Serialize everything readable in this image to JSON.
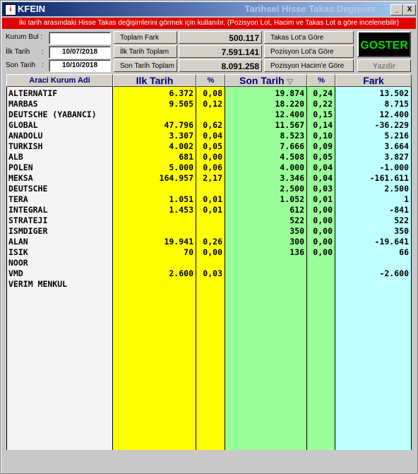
{
  "window": {
    "app_name": "KFEIN",
    "title": "Tarihsel Hisse Takas Degisimi",
    "icon": "app-icon",
    "min_label": "_",
    "close_label": "X"
  },
  "info_banner": "İki tarih arasındaki Hisse Takas değişimlerini görmek için kullanılır. (Pozisyon Lot, Hacim ve Takas Lot a göre incelenebilir)",
  "form": {
    "kurum_bul_label": "Kurum Bul :",
    "kurum_bul_value": "",
    "ilk_tarih_label": "İlk Tarih",
    "ilk_tarih_value": "10/07/2018",
    "son_tarih_label": "Son Tarih",
    "colon": ":",
    "son_tarih_value": "10/10/2018"
  },
  "totals": {
    "toplam_fark_label": "Toplam Fark",
    "toplam_fark_value": "500.117",
    "ilk_tarih_toplam_label": "İlk Tarih Toplam",
    "ilk_tarih_toplam_value": "7.591.141",
    "son_tarih_toplam_label": "Son Tarih Toplam",
    "son_tarih_toplam_value": "8.091.258"
  },
  "options": {
    "takas_lot": "Takas Lot'a Göre",
    "pozisyon_lot": "Pozisyon Lot'a Göre",
    "pozisyon_hacim": "Pozisyon Hacim'e Göre"
  },
  "actions": {
    "goster": "GOSTER",
    "yazdir": "Yazdir"
  },
  "table": {
    "headers": {
      "kurum": "Araci Kurum Adi",
      "ilk_tarih": "Ilk Tarih",
      "pct1": "%",
      "son_tarih": "Son Tarih",
      "son_tarih_sort": "▽",
      "pct2": "%",
      "fark": "Fark"
    },
    "colors": {
      "kurum_bg": "#f4f4f4",
      "ilk_bg": "#ffff00",
      "son_bg": "#99ff99",
      "fark_bg": "#c0ffff"
    },
    "rows": [
      {
        "kurum": "ALTERNATIF",
        "ilk": "6.372",
        "p1": "0,08",
        "son": "19.874",
        "p2": "0,24",
        "fark": "13.502"
      },
      {
        "kurum": "MARBAS",
        "ilk": "9.505",
        "p1": "0,12",
        "son": "18.220",
        "p2": "0,22",
        "fark": "8.715"
      },
      {
        "kurum": "DEUTSCHE (YABANCI)",
        "ilk": "",
        "p1": "",
        "son": "12.400",
        "p2": "0,15",
        "fark": "12.400"
      },
      {
        "kurum": "GLOBAL",
        "ilk": "47.796",
        "p1": "0,62",
        "son": "11.567",
        "p2": "0,14",
        "fark": "-36.229"
      },
      {
        "kurum": "ANADOLU",
        "ilk": "3.307",
        "p1": "0,04",
        "son": "8.523",
        "p2": "0,10",
        "fark": "5.216"
      },
      {
        "kurum": "TURKISH",
        "ilk": "4.002",
        "p1": "0,05",
        "son": "7.666",
        "p2": "0,09",
        "fark": "3.664"
      },
      {
        "kurum": "ALB",
        "ilk": "681",
        "p1": "0,00",
        "son": "4.508",
        "p2": "0,05",
        "fark": "3.827"
      },
      {
        "kurum": "POLEN",
        "ilk": "5.000",
        "p1": "0,06",
        "son": "4.000",
        "p2": "0,04",
        "fark": "-1.000"
      },
      {
        "kurum": "MEKSA",
        "ilk": "164.957",
        "p1": "2,17",
        "son": "3.346",
        "p2": "0,04",
        "fark": "-161.611"
      },
      {
        "kurum": "DEUTSCHE",
        "ilk": "",
        "p1": "",
        "son": "2.500",
        "p2": "0,03",
        "fark": "2.500"
      },
      {
        "kurum": "TERA",
        "ilk": "1.051",
        "p1": "0,01",
        "son": "1.052",
        "p2": "0,01",
        "fark": "1"
      },
      {
        "kurum": "INTEGRAL",
        "ilk": "1.453",
        "p1": "0,01",
        "son": "612",
        "p2": "0,00",
        "fark": "-841"
      },
      {
        "kurum": "STRATEJI",
        "ilk": "",
        "p1": "",
        "son": "522",
        "p2": "0,00",
        "fark": "522"
      },
      {
        "kurum": "ISMDIGER",
        "ilk": "",
        "p1": "",
        "son": "350",
        "p2": "0,00",
        "fark": "350"
      },
      {
        "kurum": "ALAN",
        "ilk": "19.941",
        "p1": "0,26",
        "son": "300",
        "p2": "0,00",
        "fark": "-19.641"
      },
      {
        "kurum": "ISIK",
        "ilk": "70",
        "p1": "0,00",
        "son": "136",
        "p2": "0,00",
        "fark": "66"
      },
      {
        "kurum": "NOOR",
        "ilk": "",
        "p1": "",
        "son": "",
        "p2": "",
        "fark": ""
      },
      {
        "kurum": "VMD",
        "ilk": "2.600",
        "p1": "0,03",
        "son": "",
        "p2": "",
        "fark": "-2.600"
      },
      {
        "kurum": "VERIM MENKUL",
        "ilk": "",
        "p1": "",
        "son": "",
        "p2": "",
        "fark": ""
      }
    ]
  }
}
